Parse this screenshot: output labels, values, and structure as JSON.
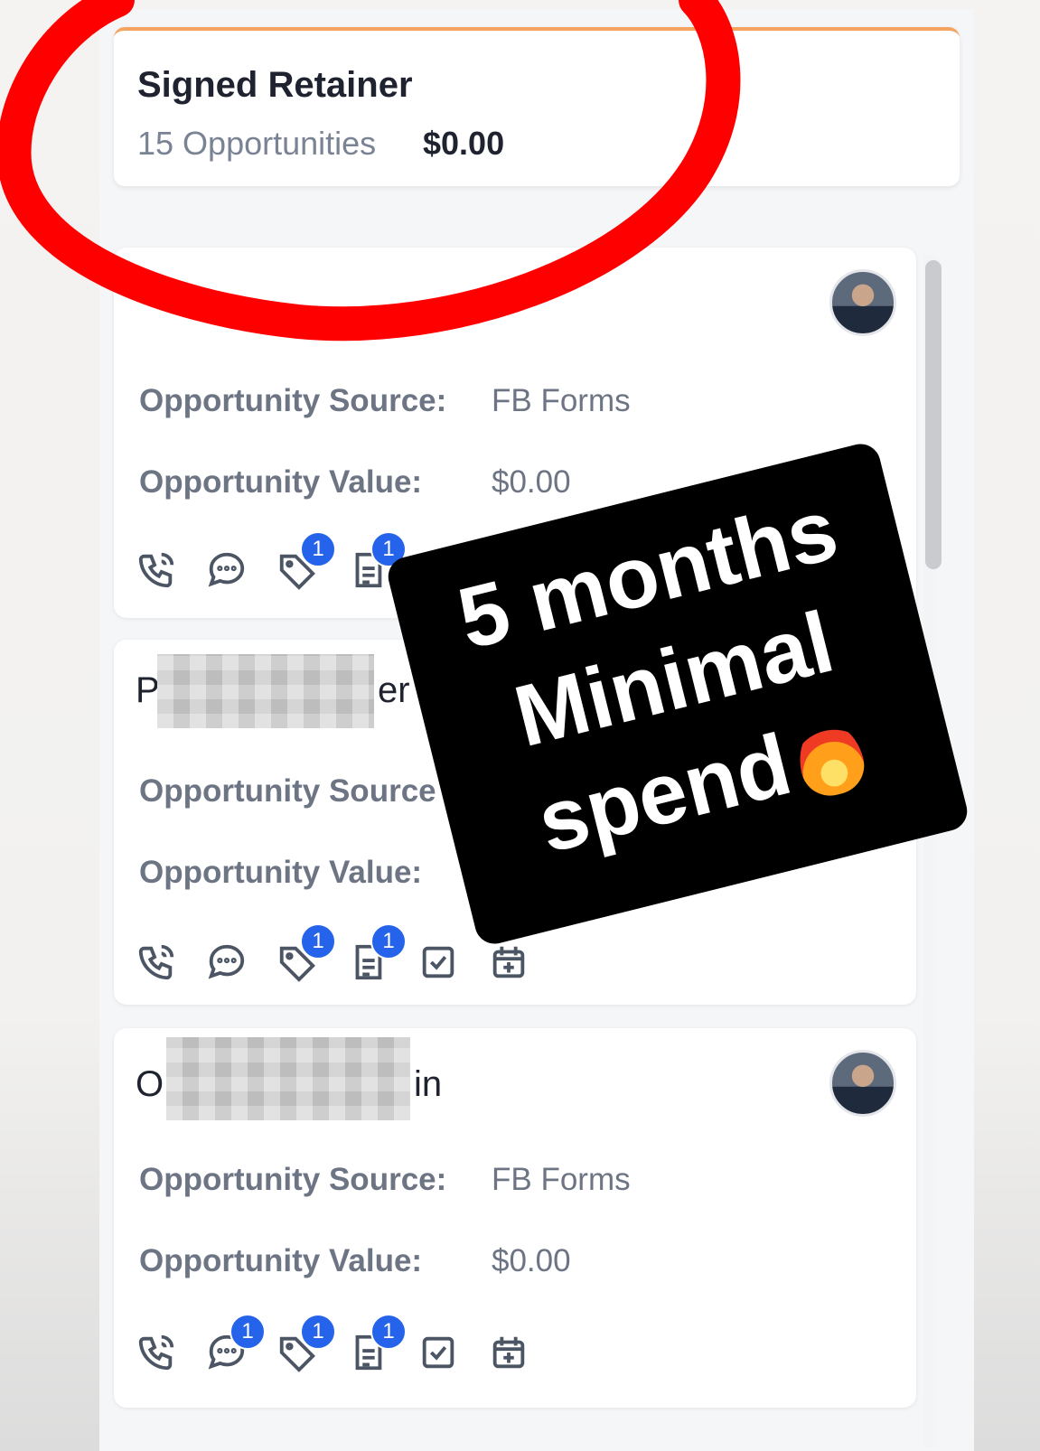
{
  "pipeline_stage": {
    "title": "Signed Retainer",
    "count_label": "15 Opportunities",
    "total_value": "$0.00",
    "accent_color": "#f4a460"
  },
  "cards": [
    {
      "name_partial": "",
      "name_obscured": true,
      "has_avatar": true,
      "source_label": "Opportunity Source:",
      "source_value": "FB Forms",
      "value_label": "Opportunity Value:",
      "value_value": "$0.00",
      "icons": [
        {
          "name": "phone-icon",
          "badge": null
        },
        {
          "name": "message-icon",
          "badge": null
        },
        {
          "name": "tag-icon",
          "badge": "1"
        },
        {
          "name": "note-icon",
          "badge": "1"
        },
        {
          "name": "task-icon",
          "badge": null
        },
        {
          "name": "calendar-icon",
          "badge": null
        }
      ]
    },
    {
      "name_prefix": "P",
      "name_suffix": "er",
      "name_obscured": true,
      "has_avatar": false,
      "source_label": "Opportunity Source",
      "value_label": "Opportunity Value:",
      "icons": [
        {
          "name": "phone-icon",
          "badge": null
        },
        {
          "name": "message-icon",
          "badge": null
        },
        {
          "name": "tag-icon",
          "badge": "1"
        },
        {
          "name": "note-icon",
          "badge": "1"
        },
        {
          "name": "task-icon",
          "badge": null
        },
        {
          "name": "calendar-icon",
          "badge": null
        }
      ]
    },
    {
      "name_prefix": "O",
      "name_suffix": "in",
      "name_obscured": true,
      "has_avatar": true,
      "source_label": "Opportunity Source:",
      "source_value": "FB Forms",
      "value_label": "Opportunity Value:",
      "value_value": "$0.00",
      "icons": [
        {
          "name": "phone-icon",
          "badge": null
        },
        {
          "name": "message-icon",
          "badge": "1"
        },
        {
          "name": "tag-icon",
          "badge": "1"
        },
        {
          "name": "note-icon",
          "badge": "1"
        },
        {
          "name": "task-icon",
          "badge": null
        },
        {
          "name": "calendar-icon",
          "badge": null
        }
      ]
    }
  ],
  "overlay": {
    "sticker_line1": "5 months",
    "sticker_line2": "Minimal",
    "sticker_line3": "spend",
    "sticker_emoji": "fire-icon",
    "annotation_color": "#ff0000"
  }
}
